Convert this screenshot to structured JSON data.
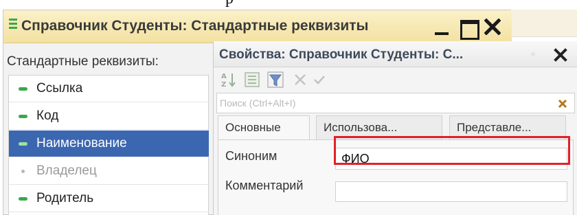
{
  "page_caption": "p",
  "window": {
    "title": "Справочник Студенты: Стандартные реквизиты"
  },
  "left_panel": {
    "label": "Стандартные реквизиты:",
    "items": [
      {
        "label": "Ссылка",
        "icon": "green-dash-icon",
        "state": "normal"
      },
      {
        "label": "Код",
        "icon": "green-dash-icon",
        "state": "normal"
      },
      {
        "label": "Наименование",
        "icon": "green-dash-icon",
        "state": "selected"
      },
      {
        "label": "Владелец",
        "icon": "gray-dot-icon",
        "state": "disabled"
      },
      {
        "label": "Родитель",
        "icon": "green-dash-icon",
        "state": "normal"
      }
    ]
  },
  "properties": {
    "title": "Свойства: Справочник Студенты: С...",
    "search_placeholder": "Поиск (Ctrl+Alt+I)",
    "tabs": [
      {
        "label": "Основные",
        "active": true
      },
      {
        "label": "Использова...",
        "active": false
      },
      {
        "label": "Представле...",
        "active": false
      }
    ],
    "fields": {
      "synonym_label": "Синоним",
      "synonym_value": "ФИО",
      "comment_label": "Комментарий",
      "comment_value": ""
    }
  },
  "colors": {
    "title_bar": "#f3e1a0",
    "selected_row": "#3b67b0",
    "accent_green": "#3aa84a",
    "highlight_frame": "#e0202a"
  }
}
